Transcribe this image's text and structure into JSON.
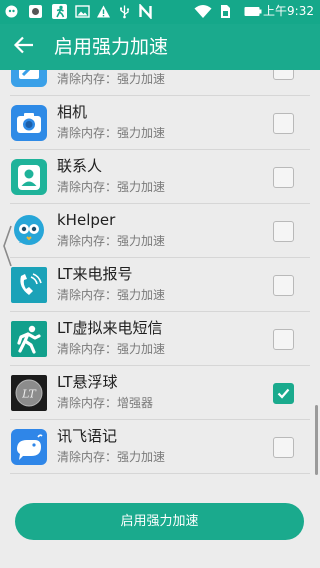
{
  "status_bar": {
    "time": "上午9:32",
    "icons": [
      "bubble-icon",
      "app-icon",
      "running-man-icon",
      "photo-icon",
      "warning-icon",
      "usb-icon",
      "n-icon",
      "wifi-icon",
      "sim-icon",
      "battery-icon"
    ]
  },
  "header": {
    "title": "启用强力加速"
  },
  "app_list": [
    {
      "name": "",
      "subtitle": "清除内存：强力加速",
      "checked": false,
      "icon": "partial-app-icon"
    },
    {
      "name": "相机",
      "subtitle": "清除内存：强力加速",
      "checked": false,
      "icon": "camera-icon"
    },
    {
      "name": "联系人",
      "subtitle": "清除内存：强力加速",
      "checked": false,
      "icon": "contacts-icon"
    },
    {
      "name": "kHelper",
      "subtitle": "清除内存：强力加速",
      "checked": false,
      "icon": "khelper-icon"
    },
    {
      "name": "LT来电报号",
      "subtitle": "清除内存：强力加速",
      "checked": false,
      "icon": "lt-caller-icon"
    },
    {
      "name": "LT虚拟来电短信",
      "subtitle": "清除内存：强力加速",
      "checked": false,
      "icon": "lt-virtual-call-icon"
    },
    {
      "name": "LT悬浮球",
      "subtitle": "清除内存：增强器",
      "checked": true,
      "icon": "lt-float-ball-icon"
    },
    {
      "name": "讯飞语记",
      "subtitle": "清除内存：强力加速",
      "checked": false,
      "icon": "iflynote-icon"
    }
  ],
  "footer": {
    "button_label": "启用强力加速"
  },
  "colors": {
    "accent": "#1aaa8d",
    "background": "#ececec"
  }
}
